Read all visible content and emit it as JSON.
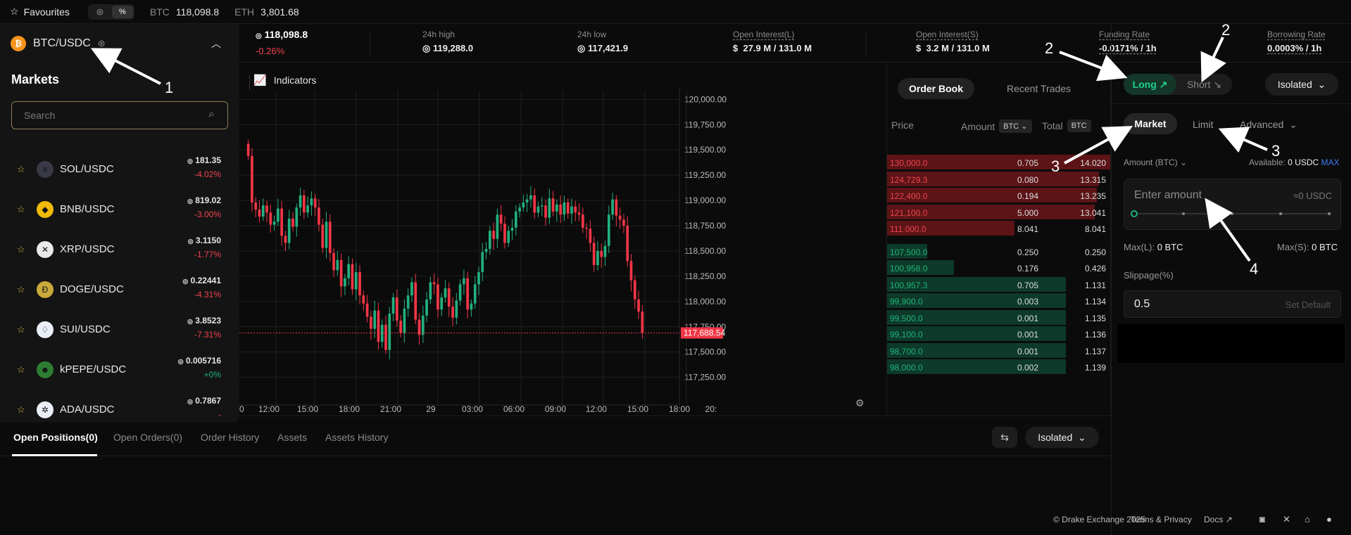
{
  "topbar": {
    "favourites_label": "Favourites",
    "toggle": [
      "◎",
      "%"
    ],
    "tickers": [
      {
        "sym": "BTC",
        "price": "118,098.8"
      },
      {
        "sym": "ETH",
        "price": "3,801.68"
      }
    ]
  },
  "stats": {
    "price": "118,098.8",
    "change": "-0.26%",
    "high_label": "24h high",
    "high": "119,288.0",
    "low_label": "24h low",
    "low": "117,421.9",
    "oil_label": "Open Interest(L)",
    "oil": "27.9 M / 131.0 M",
    "ois_label": "Open Interest(S)",
    "ois": "3.2 M / 131.0 M",
    "funding_label": "Funding Rate",
    "funding": "-0.0171% / 1h",
    "borrow_label": "Borrowing Rate",
    "borrow": "0.0003% / 1h"
  },
  "markets": {
    "pair": "BTC/USDC",
    "title": "Markets",
    "search_placeholder": "Search",
    "items": [
      {
        "name": "SOL/USDC",
        "price": "181.35",
        "change": "-4.02%",
        "color": "#3a3a46",
        "glyph": "≡"
      },
      {
        "name": "BNB/USDC",
        "price": "819.02",
        "change": "-3.00%",
        "color": "#f0b90b",
        "glyph": "◆"
      },
      {
        "name": "XRP/USDC",
        "price": "3.1150",
        "change": "-1.77%",
        "color": "#e9e9e9",
        "glyph": "✕"
      },
      {
        "name": "DOGE/USDC",
        "price": "0.22441",
        "change": "-4.31%",
        "color": "#c9a93b",
        "glyph": "Ð"
      },
      {
        "name": "SUI/USDC",
        "price": "3.8523",
        "change": "-7.31%",
        "color": "#e9eef7",
        "glyph": "♢"
      },
      {
        "name": "kPEPE/USDC",
        "price": "0.005716",
        "change": "+0%",
        "color": "#2e7d32",
        "glyph": "☻"
      },
      {
        "name": "ADA/USDC",
        "price": "0.7867",
        "change": "-",
        "color": "#e9eef7",
        "glyph": "✲"
      }
    ]
  },
  "chart": {
    "indicators_label": "Indicators",
    "last_price": "117,688.54",
    "yticks": [
      "120,000.00",
      "119,750.00",
      "119,500.00",
      "119,250.00",
      "119,000.00",
      "118,750.00",
      "118,500.00",
      "118,250.00",
      "118,000.00",
      "117,750.00",
      "117,500.00",
      "117,250.00"
    ],
    "xticks": [
      "0",
      "12:00",
      "15:00",
      "18:00",
      "21:00",
      "29",
      "03:00",
      "06:00",
      "09:00",
      "12:00",
      "15:00",
      "18:00",
      "20:"
    ]
  },
  "chart_data": {
    "type": "candlestick",
    "ylim": [
      117150,
      120100
    ],
    "last": 117688.54,
    "closes": [
      119440,
      118980,
      118910,
      118840,
      118950,
      118880,
      118760,
      118790,
      118920,
      118650,
      118580,
      118820,
      118740,
      118930,
      119050,
      118880,
      118950,
      119020,
      118930,
      118760,
      118530,
      118790,
      118480,
      118310,
      118410,
      118150,
      118230,
      118370,
      118120,
      118290,
      118060,
      117980,
      117850,
      117730,
      117910,
      117600,
      117770,
      117520,
      117880,
      118040,
      117810,
      117690,
      117930,
      118060,
      118190,
      117820,
      117670,
      117860,
      118020,
      118190,
      118170,
      117920,
      118040,
      118130,
      117950,
      117840,
      118010,
      118170,
      118230,
      117920,
      117980,
      118170,
      118290,
      118490,
      118520,
      118700,
      118620,
      118860,
      118770,
      118580,
      118700,
      118730,
      118890,
      118930,
      118980,
      119010,
      119050,
      118880,
      118940,
      118950,
      118830,
      119020,
      118890,
      118960,
      118860,
      118980,
      118870,
      118940,
      118880,
      118860,
      118730,
      118720,
      118580,
      118360,
      118500,
      118440,
      118550,
      118860,
      119010,
      118850,
      118810,
      118750,
      118400,
      118210,
      118020,
      117900,
      117690
    ]
  },
  "orderbook": {
    "tabs": [
      "Order Book",
      "Recent Trades"
    ],
    "headers": {
      "price": "Price",
      "amount": "Amount",
      "unit": "BTC",
      "total": "Total",
      "total_unit": "BTC"
    },
    "asks": [
      {
        "price": "130,000.0",
        "amount": "0.705",
        "total": "14.020",
        "depth": 100
      },
      {
        "price": "124,729.3",
        "amount": "0.080",
        "total": "13.315",
        "depth": 95
      },
      {
        "price": "122,400.0",
        "amount": "0.194",
        "total": "13.235",
        "depth": 94
      },
      {
        "price": "121,100.0",
        "amount": "5.000",
        "total": "13.041",
        "depth": 93
      },
      {
        "price": "111,000.0",
        "amount": "8.041",
        "total": "8.041",
        "depth": 57
      }
    ],
    "bids": [
      {
        "price": "107,500.0",
        "amount": "0.250",
        "total": "0.250",
        "depth": 18
      },
      {
        "price": "100,958.0",
        "amount": "0.176",
        "total": "0.426",
        "depth": 30
      },
      {
        "price": "100,957.3",
        "amount": "0.705",
        "total": "1.131",
        "depth": 80
      },
      {
        "price": "99,900.0",
        "amount": "0.003",
        "total": "1.134",
        "depth": 80
      },
      {
        "price": "99,500.0",
        "amount": "0.001",
        "total": "1.135",
        "depth": 80
      },
      {
        "price": "99,100.0",
        "amount": "0.001",
        "total": "1.136",
        "depth": 80
      },
      {
        "price": "98,700.0",
        "amount": "0.001",
        "total": "1.137",
        "depth": 80
      },
      {
        "price": "98,000.0",
        "amount": "0.002",
        "total": "1.139",
        "depth": 80
      }
    ]
  },
  "trade": {
    "long": "Long",
    "short": "Short",
    "margin": "Isolated",
    "types": [
      "Market",
      "Limit",
      "Advanced"
    ],
    "amount_label": "Amount (BTC)",
    "available_label": "Available:",
    "available": "0 USDC",
    "max": "MAX",
    "amount_placeholder": "Enter amount",
    "approx": "≈0 USDC",
    "maxl_label": "Max(L):",
    "maxl": "0 BTC",
    "maxs_label": "Max(S):",
    "maxs": "0 BTC",
    "slippage_label": "Slippage(%)",
    "slippage": "0.5",
    "set_default": "Set Default"
  },
  "bottom": {
    "tabs": [
      "Open Positions(0)",
      "Open Orders(0)",
      "Order History",
      "Assets",
      "Assets History"
    ],
    "margin": "Isolated"
  },
  "footer": {
    "copyright": "© Drake Exchange 2025",
    "terms": "Terms",
    "amp": "&",
    "privacy": "Privacy",
    "docs": "Docs"
  },
  "annotations": [
    "1",
    "2",
    "2",
    "3",
    "3",
    "4"
  ]
}
